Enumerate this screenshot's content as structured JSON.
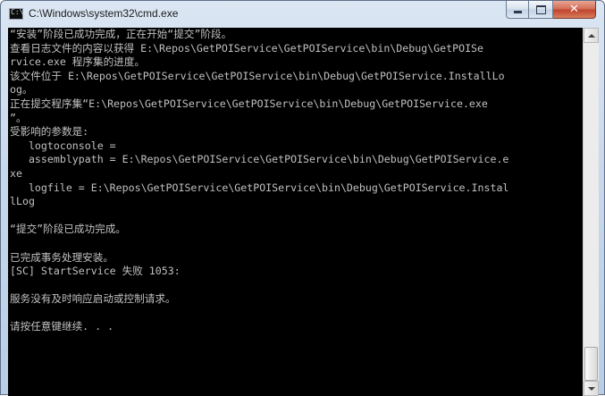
{
  "window": {
    "title": "C:\\Windows\\system32\\cmd.exe",
    "icon_glyph": "C:\\",
    "controls": {
      "minimize": "minimize-icon",
      "maximize": "maximize-icon",
      "close": "close-icon",
      "close_glyph": "✕"
    }
  },
  "console": {
    "lines": [
      "“安装”阶段已成功完成，正在开始“提交”阶段。",
      "查看日志文件的内容以获得 E:\\Repos\\GetPOIService\\GetPOIService\\bin\\Debug\\GetPOISe",
      "rvice.exe 程序集的进度。",
      "该文件位于 E:\\Repos\\GetPOIService\\GetPOIService\\bin\\Debug\\GetPOIService.InstallLo",
      "og。",
      "正在提交程序集“E:\\Repos\\GetPOIService\\GetPOIService\\bin\\Debug\\GetPOIService.exe",
      "”。",
      "受影响的参数是:",
      "   logtoconsole =",
      "   assemblypath = E:\\Repos\\GetPOIService\\GetPOIService\\bin\\Debug\\GetPOIService.e",
      "xe",
      "   logfile = E:\\Repos\\GetPOIService\\GetPOIService\\bin\\Debug\\GetPOIService.Instal",
      "lLog",
      "",
      "“提交”阶段已成功完成。",
      "",
      "已完成事务处理安装。",
      "[SC] StartService 失败 1053:",
      "",
      "服务没有及时响应启动或控制请求。",
      "",
      "请按任意键继续. . .",
      "",
      "",
      ""
    ]
  },
  "scrollbar": {
    "up_icon": "scroll-up-arrow-icon",
    "down_icon": "scroll-down-arrow-icon"
  },
  "colors": {
    "console_background": "#000000",
    "console_text": "#c0c0c0",
    "close_button": "#c0462f"
  }
}
